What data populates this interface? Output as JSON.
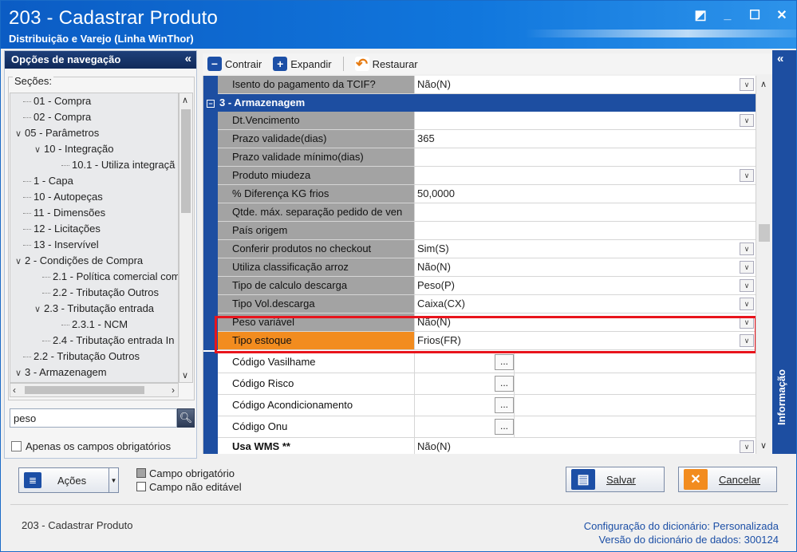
{
  "window": {
    "title": "203 - Cadastrar  Produto",
    "subtitle": "Distribuição e Varejo (Linha WinThor)"
  },
  "nav": {
    "header": "Opções de navegação",
    "sections_label": "Seções:",
    "items": [
      {
        "label": "01 - Compra",
        "indent": 0,
        "chev": ""
      },
      {
        "label": "02 - Compra",
        "indent": 0,
        "chev": ""
      },
      {
        "label": "05 - Parâmetros",
        "indent": 0,
        "chev": "∨"
      },
      {
        "label": "10 - Integração",
        "indent": 1,
        "chev": "∨"
      },
      {
        "label": "10.1 - Utiliza integraçã",
        "indent": 2,
        "chev": ""
      },
      {
        "label": "1 - Capa",
        "indent": 0,
        "chev": ""
      },
      {
        "label": "10 - Autopeças",
        "indent": 0,
        "chev": ""
      },
      {
        "label": "11 - Dimensões",
        "indent": 0,
        "chev": ""
      },
      {
        "label": "12 - Licitações",
        "indent": 0,
        "chev": ""
      },
      {
        "label": "13 - Inservível",
        "indent": 0,
        "chev": ""
      },
      {
        "label": "2 - Condições de Compra",
        "indent": 0,
        "chev": "∨"
      },
      {
        "label": "2.1 - Política comercial com",
        "indent": 1,
        "chev": ""
      },
      {
        "label": "2.2 - Tributação Outros",
        "indent": 1,
        "chev": ""
      },
      {
        "label": "2.3 - Tributação entrada",
        "indent": 1,
        "chev": "∨"
      },
      {
        "label": "2.3.1 - NCM",
        "indent": 2,
        "chev": ""
      },
      {
        "label": "2.4 - Tributação entrada In",
        "indent": 1,
        "chev": ""
      },
      {
        "label": "2.2 - Tributação Outros",
        "indent": 0,
        "chev": ""
      },
      {
        "label": "3 - Armazenagem",
        "indent": 0,
        "chev": "∨"
      }
    ],
    "search_value": "peso",
    "required_only_label": "Apenas os campos obrigatórios"
  },
  "toolbar": {
    "collapse": "Contrair",
    "expand": "Expandir",
    "restore": "Restaurar"
  },
  "grid": {
    "top_row": {
      "label": "Isento do pagamento da TCIF?",
      "value": "Não(N)",
      "dropdown": true
    },
    "section": "3 - Armazenagem",
    "rows": [
      {
        "label": "Dt.Vencimento",
        "value": "",
        "dropdown": true
      },
      {
        "label": "Prazo validade(dias)",
        "value": "365",
        "dropdown": false
      },
      {
        "label": "Prazo validade mínimo(dias)",
        "value": "",
        "dropdown": false
      },
      {
        "label": "Produto miudeza",
        "value": "",
        "dropdown": true
      },
      {
        "label": "% Diferença KG frios",
        "value": "50,0000",
        "dropdown": false
      },
      {
        "label": "Qtde. máx. separação pedido de ven",
        "value": "",
        "dropdown": false
      },
      {
        "label": "País origem",
        "value": "",
        "dropdown": false
      },
      {
        "label": "Conferir produtos no checkout",
        "value": "Sim(S)",
        "dropdown": true
      },
      {
        "label": "Utiliza classificação arroz",
        "value": "Não(N)",
        "dropdown": true
      },
      {
        "label": "Tipo de calculo descarga",
        "value": "Peso(P)",
        "dropdown": true
      },
      {
        "label": "Tipo Vol.descarga",
        "value": "Caixa(CX)",
        "dropdown": true
      },
      {
        "label": "Peso variável",
        "value": "Não(N)",
        "dropdown": true
      },
      {
        "label": "Tipo estoque",
        "value": "Frios(FR)",
        "dropdown": true
      }
    ],
    "lookup_rows": [
      {
        "label": "Código Vasilhame"
      },
      {
        "label": "Código Risco"
      },
      {
        "label": "Código Acondicionamento"
      },
      {
        "label": "Código Onu"
      }
    ],
    "last_row": {
      "label": "Usa WMS **",
      "value": "Não(N)"
    },
    "ellipsis": "..."
  },
  "info_panel": "Informação",
  "bottom": {
    "actions": "Ações",
    "legend_required": "Campo obrigatório",
    "legend_readonly": "Campo não editável",
    "save": "Salvar",
    "cancel": "Cancelar"
  },
  "footer": {
    "left": "203 - Cadastrar  Produto",
    "dict_config_label": "Configuração do dicionário:",
    "dict_config_value": "Personalizada",
    "dict_version_label": "Versão do dicionário de dados:",
    "dict_version_value": "300124"
  },
  "colors": {
    "title_blue": "#0b5cc4",
    "grid_label_gray": "#a3a3a3",
    "section_blue": "#1d4ea1",
    "highlight_red": "#e8141c",
    "selected_orange": "#f28c1f"
  }
}
